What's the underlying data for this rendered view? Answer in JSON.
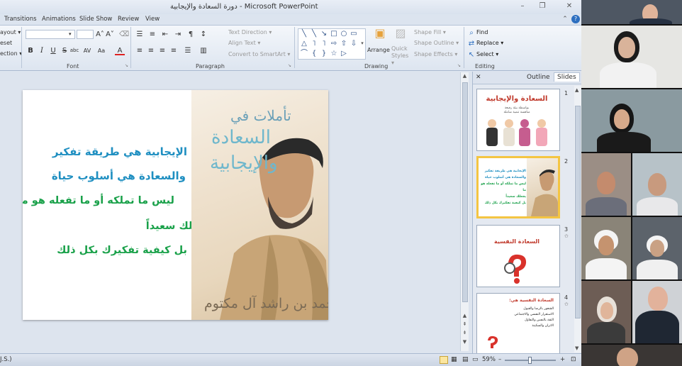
{
  "window": {
    "title": "دورة السعادة والإيجابية  -  Microsoft PowerPoint",
    "minimize": "–",
    "restore": "❐",
    "close": "✕"
  },
  "ribbon_tabs": [
    "Transitions",
    "Animations",
    "Slide Show",
    "Review",
    "View"
  ],
  "ribbon": {
    "slides_group": {
      "layout": "ayout ▾",
      "reset": "eset",
      "section": "ection ▾"
    },
    "font_group": {
      "label": "Font",
      "font_name": "",
      "font_size": "",
      "grow": "A˄",
      "shrink": "A˅",
      "clear": "⌫",
      "bold": "B",
      "italic": "I",
      "underline": "U",
      "strike": "S",
      "shadow": "abc",
      "spacing": "AV",
      "case": "Aa",
      "color": "A"
    },
    "paragraph_group": {
      "label": "Paragraph",
      "text_direction": "Text Direction ▾",
      "align_text": "Align Text ▾",
      "smartart": "Convert to SmartArt ▾"
    },
    "drawing_group": {
      "label": "Drawing",
      "arrange": "Arrange",
      "quick_styles": "Quick Styles ▾",
      "shape_fill": "Shape Fill ▾",
      "shape_outline": "Shape Outline ▾",
      "shape_effects": "Shape Effects ▾"
    },
    "editing_group": {
      "label": "Editing",
      "find": "Find",
      "replace": "Replace ▾",
      "select": "Select ▾"
    }
  },
  "slide": {
    "lines": [
      "الإيجابية هي طريقة تفكير",
      "والسعادة هي أسلوب حياة",
      "ليس ما تملكه أو ما تفعله هو ما",
      "يجعلك سعيداً",
      "بل كيفية تفكيرك بكل ذلك"
    ],
    "line_colors": [
      "#1f8fc1",
      "#1f8fc1",
      "#1aa14a",
      "#1aa14a",
      "#1aa14a"
    ],
    "art_title_1": "تأملات في",
    "art_title_2": "السعادة",
    "art_title_3": "والإيجابية",
    "art_signature": "محمد بن راشد آل مكتوم"
  },
  "panel": {
    "close": "✕",
    "tab_outline": "Outline",
    "tab_slides": "Slides",
    "thumbs": [
      {
        "num": "1",
        "title": "السعادة والإيجابية",
        "sub": "بواسطة بيئة رفيعة",
        "sub2": "منافسة تنمية شاملة"
      },
      {
        "num": "2",
        "title": "",
        "lines": [
          "الإيجابية هي طريقة تفكير",
          "والسعادة هي أسلوب حياة",
          "ليس ما تملكه أو ما تفعله هو ما",
          "يجعلك سعيداً",
          "بل كيفية تفكيرك بكل ذلك"
        ]
      },
      {
        "num": "3",
        "title": "السعادة النفسية"
      },
      {
        "num": "4",
        "title": "السعادة النفسية هي:",
        "lines": [
          "الشعور بالرضا والقبول",
          "الاستقرار النفسي والاجتماعي",
          "الثقة بالنفس والتفاؤل",
          "الاتزان والسكينة"
        ]
      }
    ]
  },
  "status": {
    "left": "J.S.)",
    "zoom": "59%",
    "zoom_minus": "–",
    "zoom_plus": "+"
  }
}
